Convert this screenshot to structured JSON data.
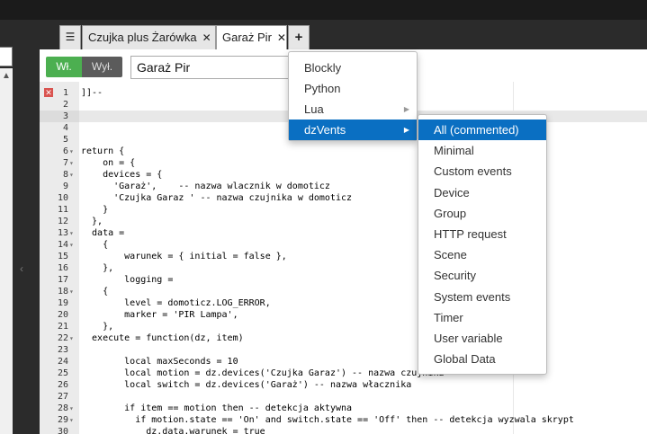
{
  "tabs": {
    "menu_icon": "☰",
    "items": [
      {
        "label": "Czujka plus Żarówka",
        "close": "✕"
      },
      {
        "label": "Garaż Pir",
        "close": "✕"
      }
    ],
    "add_label": "+"
  },
  "toolbar": {
    "on_label": "Wł.",
    "off_label": "Wył.",
    "script_name": "Garaż Pir"
  },
  "editor": {
    "error_icon": "✕",
    "lines": [
      {
        "n": "1",
        "fold": "",
        "code": "]]--"
      },
      {
        "n": "2",
        "fold": "",
        "code": ""
      },
      {
        "n": "3",
        "fold": "",
        "code": ""
      },
      {
        "n": "4",
        "fold": "",
        "code": ""
      },
      {
        "n": "5",
        "fold": "",
        "code": ""
      },
      {
        "n": "6",
        "fold": "▾",
        "code": "return {"
      },
      {
        "n": "7",
        "fold": "▾",
        "code": "    on = {"
      },
      {
        "n": "8",
        "fold": "▾",
        "code": "    devices = {"
      },
      {
        "n": "9",
        "fold": "",
        "code": "      'Garaż',    -- nazwa wlacznik w domoticz"
      },
      {
        "n": "10",
        "fold": "",
        "code": "      'Czujka Garaz ' -- nazwa czujnika w domoticz"
      },
      {
        "n": "11",
        "fold": "",
        "code": "    }"
      },
      {
        "n": "12",
        "fold": "",
        "code": "  },"
      },
      {
        "n": "13",
        "fold": "▾",
        "code": "  data ="
      },
      {
        "n": "14",
        "fold": "▾",
        "code": "    {"
      },
      {
        "n": "15",
        "fold": "",
        "code": "        warunek = { initial = false },"
      },
      {
        "n": "16",
        "fold": "",
        "code": "    },"
      },
      {
        "n": "17",
        "fold": "",
        "code": "        logging ="
      },
      {
        "n": "18",
        "fold": "▾",
        "code": "    {"
      },
      {
        "n": "19",
        "fold": "",
        "code": "        level = domoticz.LOG_ERROR,"
      },
      {
        "n": "20",
        "fold": "",
        "code": "        marker = 'PIR Lampa',"
      },
      {
        "n": "21",
        "fold": "",
        "code": "    },"
      },
      {
        "n": "22",
        "fold": "▾",
        "code": "  execute = function(dz, item)"
      },
      {
        "n": "23",
        "fold": "",
        "code": ""
      },
      {
        "n": "24",
        "fold": "",
        "code": "        local maxSeconds = 10"
      },
      {
        "n": "25",
        "fold": "",
        "code": "        local motion = dz.devices('Czujka Garaz') -- nazwa czujnika"
      },
      {
        "n": "26",
        "fold": "",
        "code": "        local switch = dz.devices('Garaż') -- nazwa włacznika"
      },
      {
        "n": "27",
        "fold": "",
        "code": ""
      },
      {
        "n": "28",
        "fold": "▾",
        "code": "        if item == motion then -- detekcja aktywna"
      },
      {
        "n": "29",
        "fold": "▾",
        "code": "          if motion.state == 'On' and switch.state == 'Off' then -- detekcja wyzwala skrypt"
      },
      {
        "n": "30",
        "fold": "",
        "code": "            dz.data.warunek = true"
      }
    ]
  },
  "language_menu": {
    "items": [
      {
        "label": "Blockly",
        "arrow": ""
      },
      {
        "label": "Python",
        "arrow": ""
      },
      {
        "label": "Lua",
        "arrow": "▶"
      },
      {
        "label": "dzVents",
        "arrow": "▶"
      }
    ],
    "active_index": 3
  },
  "template_menu": {
    "items": [
      "All (commented)",
      "Minimal",
      "Custom events",
      "Device",
      "Group",
      "HTTP request",
      "Scene",
      "Security",
      "System events",
      "Timer",
      "User variable",
      "Global Data"
    ],
    "active_index": 0
  },
  "colors": {
    "accent": "#0a6fc2",
    "on_button": "#4caf50",
    "off_button": "#5b5b5b",
    "error": "#d9534f"
  }
}
